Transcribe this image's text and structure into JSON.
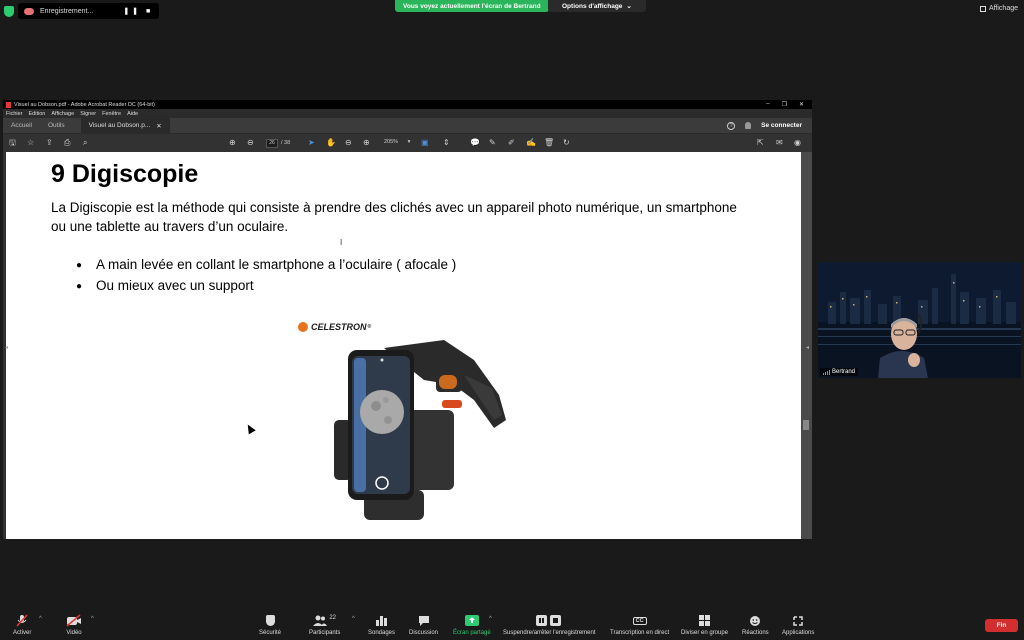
{
  "zoom_top": {
    "recording_label": "Enregistrement...",
    "recording_controls": "❚❚ ■",
    "share_banner": "Vous voyez actuellement l'écran de Bertrand",
    "view_options": "Options d'affichage",
    "view_options_caret": "⌄",
    "affichage": "Affichage"
  },
  "acrobat": {
    "title": "Visuel au Dobson.pdf - Adobe Acrobat Reader DC (64-bit)",
    "window_min": "–",
    "window_max": "❐",
    "window_close": "✕",
    "menu": [
      "Fichier",
      "Edition",
      "Affichage",
      "Signer",
      "Fenêtre",
      "Aide"
    ],
    "tabs": {
      "home": "Accueil",
      "tools": "Outils",
      "doc": "Visuel au Dobson.p...",
      "doc_close": "✕"
    },
    "help_icon": "?",
    "signin": "Se connecter",
    "page_current": "26",
    "page_total": "/ 38",
    "zoom": "205%",
    "zoom_caret": "▾",
    "toolbar_glyphs": {
      "save": "🖫",
      "star": "☆",
      "upload": "⇪",
      "print": "⎙",
      "search": "⌕",
      "prev": "⊕",
      "next": "⊖",
      "select": "➤",
      "hand": "✋",
      "zoom_out": "⊖",
      "zoom_in": "⊕",
      "fit": "▣",
      "measure": "⇕",
      "comment": "💬",
      "pen": "✎",
      "draw": "✐",
      "sign": "✍",
      "delete": "🗑",
      "rotate": "↻",
      "share": "⇱",
      "mail": "✉",
      "account": "◉"
    }
  },
  "pdf_page": {
    "title": "9 Digiscopie",
    "paragraph": "La Digiscopie est la méthode qui consiste à prendre des clichés avec un appareil photo numérique, un smartphone ou une tablette au travers d’un oculaire.",
    "text_cursor": "I",
    "bullets": [
      "A main levée en collant le smartphone a l’oculaire ( afocale )",
      "Ou mieux avec un support"
    ],
    "brand": "CELESTRON",
    "brand_mark": "®"
  },
  "participant": {
    "name": "Bertrand"
  },
  "zoom_bar": {
    "audio": "Activer",
    "video": "Vidéo",
    "security": "Sécurité",
    "participants": "Participants",
    "participants_count": "22",
    "polls": "Sondages",
    "chat": "Discussion",
    "share": "Écran partagé",
    "record": "Suspendre/arrêter l'enregistrement",
    "transcription": "Transcription en direct",
    "breakout": "Diviser en groupe",
    "reactions": "Réactions",
    "apps": "Applications",
    "end": "Fin",
    "caret": "^",
    "cc_glyph": "CC"
  },
  "colors": {
    "share_green": "#2bb55a",
    "end_red": "#d32f2f",
    "celestron_orange": "#e8731e"
  }
}
